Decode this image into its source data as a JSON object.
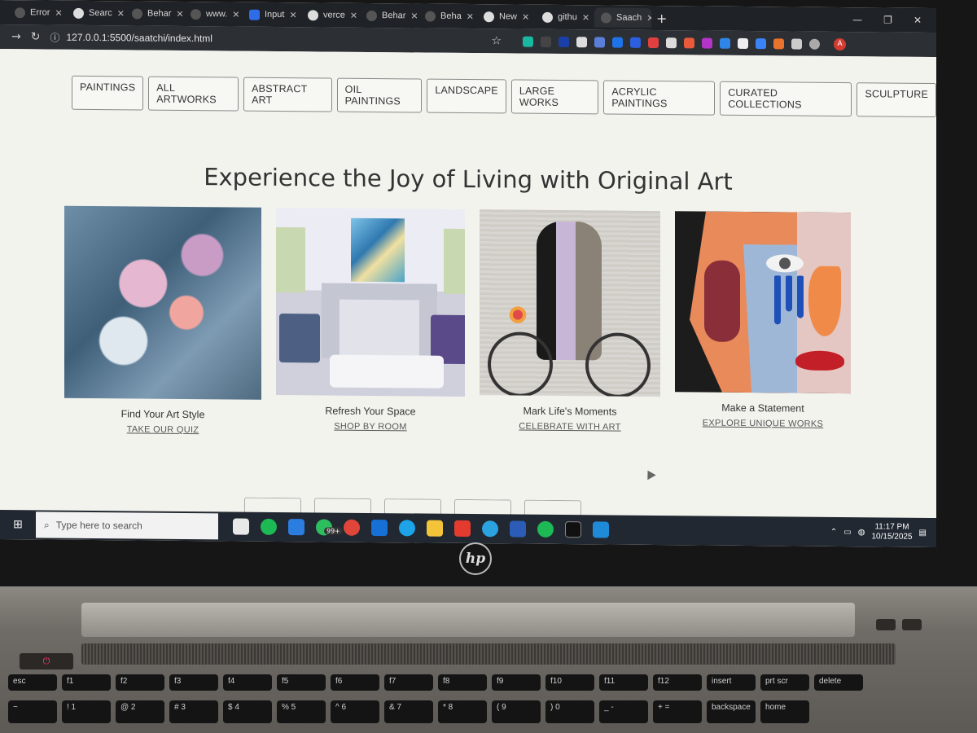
{
  "browser": {
    "tabs": [
      {
        "label": "Error",
        "icon": "globe-icon"
      },
      {
        "label": "Searc",
        "icon": "search-page-icon"
      },
      {
        "label": "Behar",
        "icon": "globe-icon"
      },
      {
        "label": "www.",
        "icon": "globe-icon"
      },
      {
        "label": "Input",
        "icon": "bootstrap-icon"
      },
      {
        "label": "verce",
        "icon": "vercel-icon"
      },
      {
        "label": "Behar",
        "icon": "globe-icon"
      },
      {
        "label": "Beha",
        "icon": "globe-icon"
      },
      {
        "label": "New",
        "icon": "chrome-icon"
      },
      {
        "label": "githu",
        "icon": "github-icon"
      },
      {
        "label": "Saach",
        "icon": "globe-icon"
      }
    ],
    "new_tab": "+",
    "address": "127.0.0.1:5500/saatchi/index.html",
    "profile_initial": "A"
  },
  "site": {
    "categories": [
      "PAINTINGS",
      "ALL ARTWORKS",
      "ABSTRACT ART",
      "OIL PAINTINGS",
      "LANDSCAPE",
      "LARGE WORKS",
      "ACRYLIC PAINTINGS",
      "CURATED COLLECTIONS",
      "SCULPTURE"
    ],
    "headline": "Experience the Joy of Living with Original Art",
    "cards": [
      {
        "title": "Find Your Art Style",
        "link": "TAKE OUR QUIZ"
      },
      {
        "title": "Refresh Your Space",
        "link": "SHOP BY ROOM"
      },
      {
        "title": "Mark Life's Moments",
        "link": "CELEBRATE WITH ART"
      },
      {
        "title": "Make a Statement",
        "link": "EXPLORE UNIQUE WORKS"
      }
    ]
  },
  "taskbar": {
    "search_placeholder": "Type here to search",
    "whatsapp_badge": "99+",
    "time": "11:17 PM",
    "date": "10/15/2025"
  },
  "laptop": {
    "brand": "hp",
    "keys_fn": [
      "esc",
      "f1",
      "f2",
      "f3",
      "f4",
      "f5",
      "f6",
      "f7",
      "f8",
      "f9",
      "f10",
      "f11",
      "f12",
      "insert",
      "prt scr",
      "delete"
    ],
    "keys_num": [
      "~",
      "! 1",
      "@ 2",
      "# 3",
      "$ 4",
      "% 5",
      "^ 6",
      "& 7",
      "* 8",
      "( 9",
      ") 0",
      "_ -",
      "+ =",
      "backspace",
      "home"
    ]
  },
  "colors": {
    "page_bg": "#f3f3ee",
    "taskbar": "#222831",
    "tabstrip": "#1f2226"
  }
}
